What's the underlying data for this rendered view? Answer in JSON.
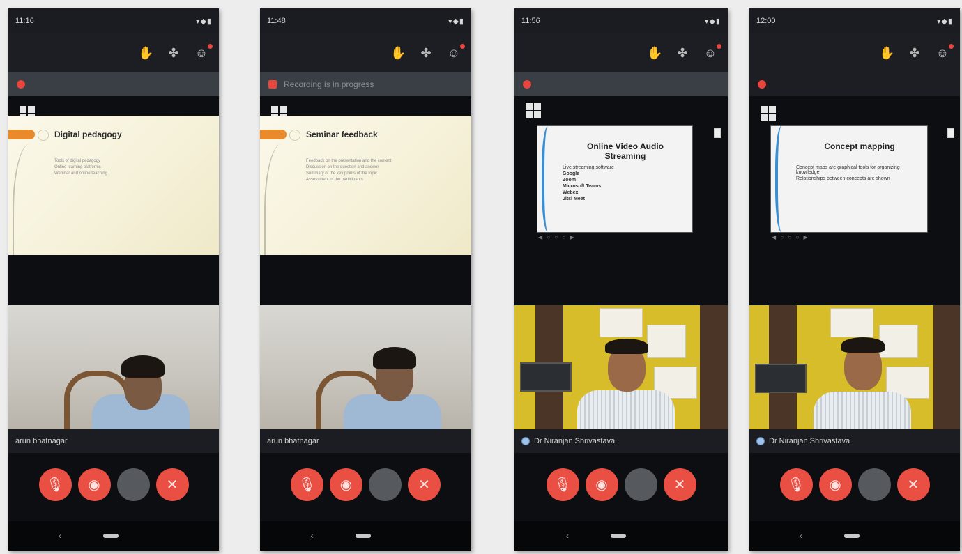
{
  "phones": [
    {
      "status_time": "11:16",
      "status_right": "▾◆▮",
      "rec_text": "",
      "slide_title": "Digital pedagogy",
      "slide_bullets": [
        "Tools of digital pedagogy",
        "Online learning platforms",
        "Webinar and online teaching"
      ],
      "video_name": "arun bhatnagar",
      "controls": [
        "mic-off",
        "video-off",
        "more",
        "end-call"
      ]
    },
    {
      "status_time": "11:48",
      "status_right": "▾◆▮",
      "rec_text": "Recording is in progress",
      "slide_title": "Seminar feedback",
      "slide_bullets": [
        "Feedback on the presentation and the content",
        "Discussion on the question and answer",
        "Summary of the key points of the topic",
        "Assessment of the participants"
      ],
      "video_name": "arun bhatnagar",
      "controls": [
        "mic-off",
        "video-off",
        "more",
        "end-call"
      ]
    },
    {
      "status_time": "11:56",
      "status_right": "▾◆▮",
      "rec_text": "",
      "slide_title": "Online Video Audio Streaming",
      "slide_body": [
        "Live streaming software",
        "Google",
        "Zoom",
        "Microsoft Teams",
        "Webex",
        "Jitsi Meet"
      ],
      "thumb_nav": "◀ ○ ○ ○ ▶",
      "video_name": "Dr Niranjan Shrivastava",
      "controls": [
        "mic-off",
        "video-off",
        "more",
        "end-call"
      ]
    },
    {
      "status_time": "12:00",
      "status_right": "▾◆▮",
      "rec_text": "",
      "slide_title": "Concept mapping",
      "slide_body": [
        "Concept maps are graphical tools for organizing knowledge",
        "Relationships between concepts are shown"
      ],
      "thumb_nav": "◀ ○ ○ ○ ▶",
      "video_name": "Dr Niranjan Shrivastava",
      "controls": [
        "mic-off",
        "video-off",
        "more",
        "end-call"
      ]
    }
  ],
  "icons": {
    "app_bar": [
      "hand-raise-icon",
      "bluetooth-icon",
      "participants-icon"
    ],
    "accent": "#e94f43",
    "muted": "#565a5f"
  }
}
